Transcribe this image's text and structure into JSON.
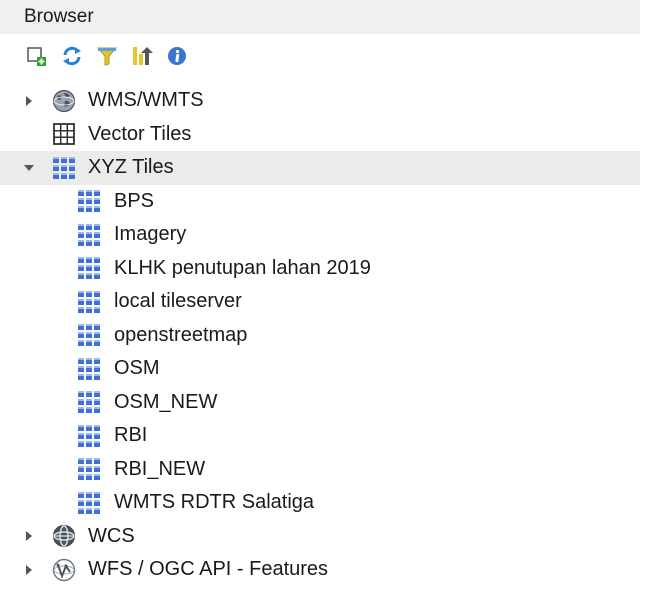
{
  "panel": {
    "title": "Browser"
  },
  "toolbar": {
    "tools": [
      {
        "icon": "add-layer-icon"
      },
      {
        "icon": "refresh-icon"
      },
      {
        "icon": "filter-icon"
      },
      {
        "icon": "collapse-all-icon"
      },
      {
        "icon": "info-icon"
      }
    ]
  },
  "tree": {
    "items": [
      {
        "label": "WMS/WMTS",
        "icon": "wms-globe-icon",
        "expanded": false
      },
      {
        "label": "Vector Tiles",
        "icon": "vector-tiles-grid-icon"
      },
      {
        "label": "XYZ Tiles",
        "icon": "xyz-tiles-icon",
        "expanded": true
      },
      {
        "label": "WCS",
        "icon": "wcs-globe-icon",
        "expanded": false
      },
      {
        "label": "WFS / OGC API - Features",
        "icon": "wfs-icon",
        "expanded": false
      }
    ],
    "xyz_children": [
      {
        "label": "BPS"
      },
      {
        "label": "Imagery"
      },
      {
        "label": "KLHK penutupan lahan 2019"
      },
      {
        "label": "local tileserver"
      },
      {
        "label": "openstreetmap"
      },
      {
        "label": "OSM"
      },
      {
        "label": "OSM_NEW"
      },
      {
        "label": "RBI"
      },
      {
        "label": "RBI_NEW"
      },
      {
        "label": "WMTS RDTR Salatiga"
      }
    ]
  },
  "colors": {
    "xyz_tile_blue": "#3f6fd8",
    "selected_row": "#ebebeb",
    "title_bar": "#f0f0f0"
  }
}
